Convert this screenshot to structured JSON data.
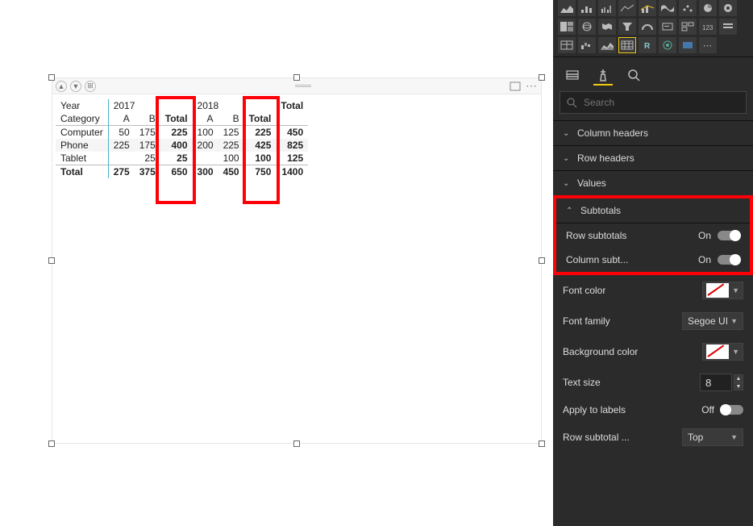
{
  "matrix": {
    "row_header_1": "Year",
    "row_header_2": "Category",
    "years": {
      "y2017": "2017",
      "y2018": "2018"
    },
    "sub": {
      "a": "A",
      "b": "B",
      "total": "Total"
    },
    "grand_total": "Total",
    "rows": [
      {
        "label": "Computer",
        "a17": "50",
        "b17": "175",
        "t17": "225",
        "a18": "100",
        "b18": "125",
        "t18": "225",
        "total": "450"
      },
      {
        "label": "Phone",
        "a17": "225",
        "b17": "175",
        "t17": "400",
        "a18": "200",
        "b18": "225",
        "t18": "425",
        "total": "825"
      },
      {
        "label": "Tablet",
        "a17": "",
        "b17": "25",
        "t17": "25",
        "a18": "",
        "b18": "100",
        "t18": "100",
        "total": "125"
      }
    ],
    "total_row": {
      "label": "Total",
      "a17": "275",
      "b17": "375",
      "t17": "650",
      "a18": "300",
      "b18": "450",
      "t18": "750",
      "total": "1400"
    }
  },
  "search": {
    "placeholder": "Search"
  },
  "sections": {
    "column_headers": "Column headers",
    "row_headers": "Row headers",
    "values": "Values",
    "subtotals": "Subtotals"
  },
  "subtotals": {
    "row_label": "Row subtotals",
    "row_state": "On",
    "col_label": "Column subt...",
    "col_state": "On"
  },
  "props": {
    "font_color": "Font color",
    "font_family_label": "Font family",
    "font_family_value": "Segoe UI",
    "bg_color": "Background color",
    "text_size_label": "Text size",
    "text_size_value": "8",
    "apply_label": "Apply to labels",
    "apply_state": "Off",
    "row_subtotal_pos_label": "Row subtotal ...",
    "row_subtotal_pos_value": "Top"
  }
}
